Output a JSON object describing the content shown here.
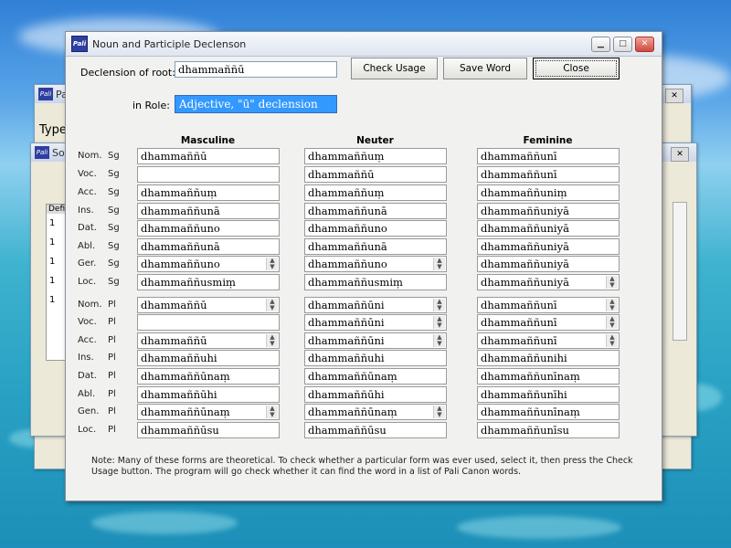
{
  "window": {
    "title": "Noun and Participle Declenson",
    "icon": "Pali"
  },
  "root": {
    "label": "Declension of root:",
    "value": "dhammaññū"
  },
  "buttons": {
    "check_usage": "Check Usage",
    "save_word": "Save Word",
    "close": "Close"
  },
  "role": {
    "label": "in Role:",
    "value": "Adjective, \"ū\" declension"
  },
  "columns": {
    "masculine": "Masculine",
    "neuter": "Neuter",
    "feminine": "Feminine"
  },
  "rows": [
    {
      "case": "Nom.",
      "num": "Sg",
      "m": "dhammaññū",
      "n": "dhammaññuṃ",
      "f": "dhammaññunī",
      "ms": false,
      "ns": false,
      "fs": false
    },
    {
      "case": "Voc.",
      "num": "Sg",
      "m": "",
      "n": "dhammaññū",
      "f": "dhammaññunī",
      "ms": false,
      "ns": false,
      "fs": false
    },
    {
      "case": "Acc.",
      "num": "Sg",
      "m": "dhammaññuṃ",
      "n": "dhammaññuṃ",
      "f": "dhammaññuniṃ",
      "ms": false,
      "ns": false,
      "fs": false
    },
    {
      "case": "Ins.",
      "num": "Sg",
      "m": "dhammaññunā",
      "n": "dhammaññunā",
      "f": "dhammaññuniyā",
      "ms": false,
      "ns": false,
      "fs": false
    },
    {
      "case": "Dat.",
      "num": "Sg",
      "m": "dhammaññuno",
      "n": "dhammaññuno",
      "f": "dhammaññuniyā",
      "ms": false,
      "ns": false,
      "fs": false
    },
    {
      "case": "Abl.",
      "num": "Sg",
      "m": "dhammaññunā",
      "n": "dhammaññunā",
      "f": "dhammaññuniyā",
      "ms": false,
      "ns": false,
      "fs": false
    },
    {
      "case": "Ger.",
      "num": "Sg",
      "m": "dhammaññuno",
      "n": "dhammaññuno",
      "f": "dhammaññuniyā",
      "ms": true,
      "ns": true,
      "fs": false
    },
    {
      "case": "Loc.",
      "num": "Sg",
      "m": "dhammaññusmiṃ",
      "n": "dhammaññusmiṃ",
      "f": "dhammaññuniyā",
      "ms": false,
      "ns": false,
      "fs": true
    },
    {
      "case": "Nom.",
      "num": "Pl",
      "m": "dhammaññū",
      "n": "dhammaññūni",
      "f": "dhammaññunī",
      "ms": true,
      "ns": true,
      "fs": true
    },
    {
      "case": "Voc.",
      "num": "Pl",
      "m": "",
      "n": "dhammaññūni",
      "f": "dhammaññunī",
      "ms": false,
      "ns": true,
      "fs": true
    },
    {
      "case": "Acc.",
      "num": "Pl",
      "m": "dhammaññū",
      "n": "dhammaññūni",
      "f": "dhammaññunī",
      "ms": true,
      "ns": true,
      "fs": true
    },
    {
      "case": "Ins.",
      "num": "Pl",
      "m": "dhammaññuhi",
      "n": "dhammaññuhi",
      "f": "dhammaññunihi",
      "ms": false,
      "ns": false,
      "fs": false
    },
    {
      "case": "Dat.",
      "num": "Pl",
      "m": "dhammaññūnaṃ",
      "n": "dhammaññūnaṃ",
      "f": "dhammaññunīnaṃ",
      "ms": false,
      "ns": false,
      "fs": false
    },
    {
      "case": "Abl.",
      "num": "Pl",
      "m": "dhammaññūhi",
      "n": "dhammaññūhi",
      "f": "dhammaññunīhi",
      "ms": false,
      "ns": false,
      "fs": false
    },
    {
      "case": "Gen.",
      "num": "Pl",
      "m": "dhammaññūnaṃ",
      "n": "dhammaññūnaṃ",
      "f": "dhammaññunīnaṃ",
      "ms": true,
      "ns": true,
      "fs": false
    },
    {
      "case": "Loc.",
      "num": "Pl",
      "m": "dhammaññūsu",
      "n": "dhammaññūsu",
      "f": "dhammaññunīsu",
      "ms": false,
      "ns": false,
      "fs": false
    }
  ],
  "note": "Note: Many of these forms are theoretical. To check whether a particular form was ever used, select it, then press the Check Usage button. The program will go check whether it can find the word in a list of Pali Canon words.",
  "background": {
    "win1_title": "Pa",
    "win1_label": "Type",
    "win2_title": "So",
    "win2_rows": [
      "Defi",
      "1",
      "1",
      "1",
      "1",
      "1",
      "1"
    ]
  },
  "colors": {
    "accent": "#3399ff",
    "title_gradient_top": "#f6f8fb",
    "close_red": "#d04a3c"
  }
}
